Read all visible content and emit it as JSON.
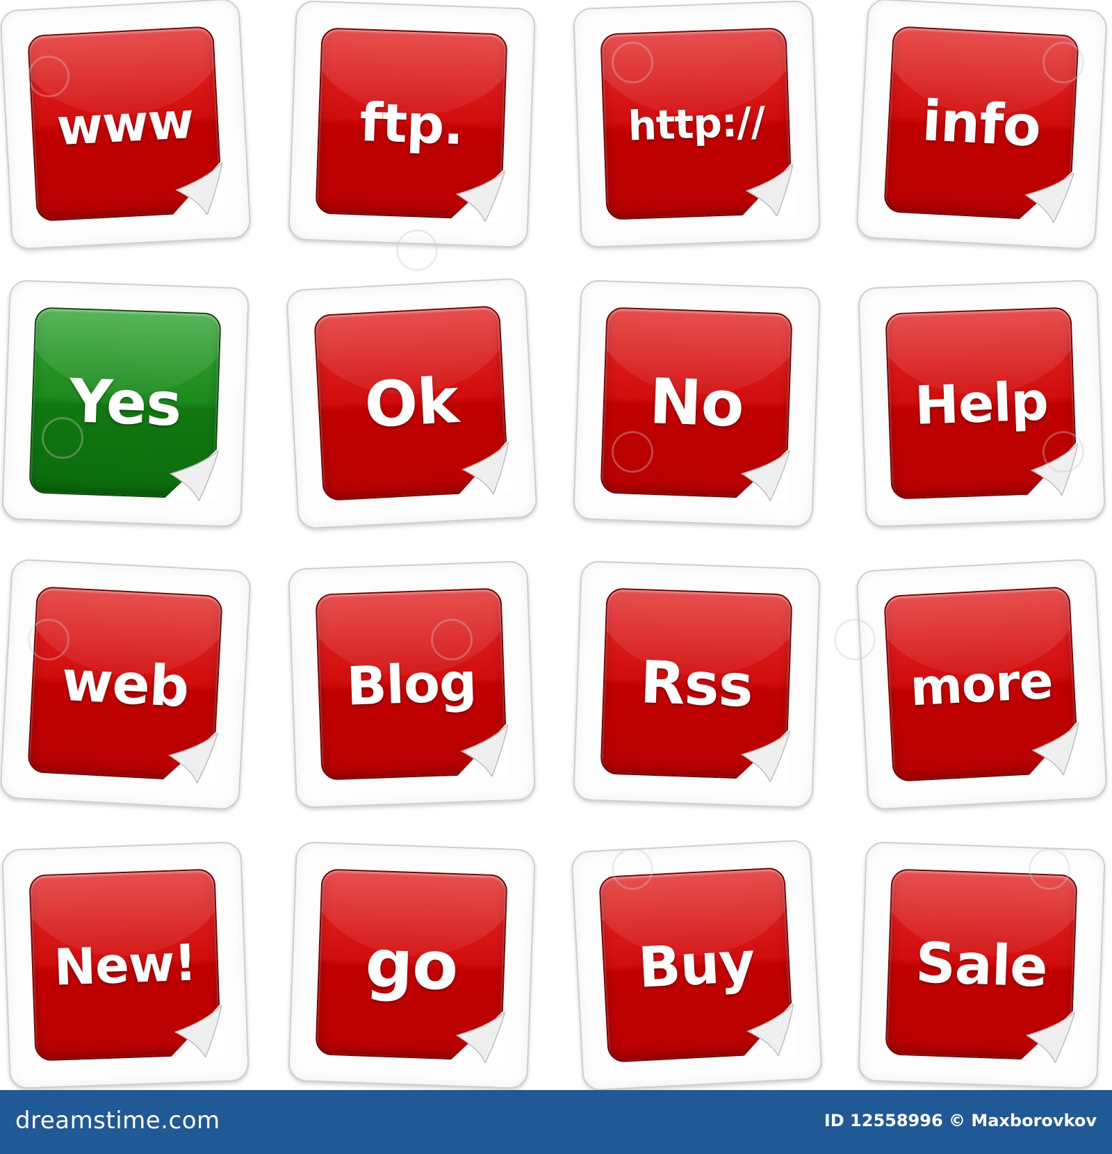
{
  "stickers": [
    {
      "text": "www",
      "color": "#c80000"
    },
    {
      "text": "ftp.",
      "color": "#c80000"
    },
    {
      "text": "http://",
      "color": "#c80000"
    },
    {
      "text": "info",
      "color": "#c80000"
    },
    {
      "text": "Yes",
      "color": "#118011"
    },
    {
      "text": "Ok",
      "color": "#c80000"
    },
    {
      "text": "No",
      "color": "#c80000"
    },
    {
      "text": "Help",
      "color": "#c80000"
    },
    {
      "text": "web",
      "color": "#c80000"
    },
    {
      "text": "Blog",
      "color": "#c80000"
    },
    {
      "text": "Rss",
      "color": "#c80000"
    },
    {
      "text": "more",
      "color": "#c80000"
    },
    {
      "text": "New!",
      "color": "#c80000"
    },
    {
      "text": "go",
      "color": "#c80000"
    },
    {
      "text": "Buy",
      "color": "#c80000"
    },
    {
      "text": "Sale",
      "color": "#c80000"
    }
  ],
  "footer": {
    "brand": "dreamstime.com",
    "credit": "ID 12558996 © Maxborovkov",
    "background": "#1f5a96"
  }
}
